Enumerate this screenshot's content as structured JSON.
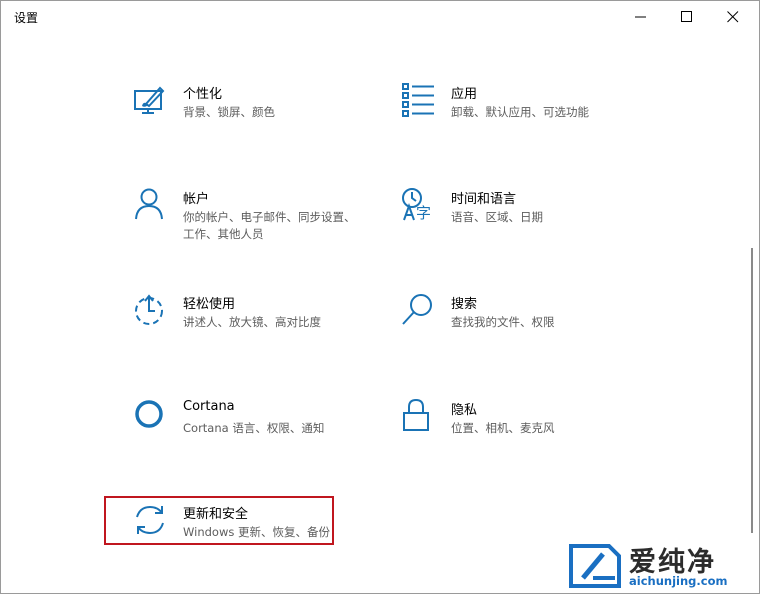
{
  "window": {
    "title": "设置"
  },
  "controls": {
    "minimize": "minimize-icon",
    "maximize": "maximize-icon",
    "close": "close-icon"
  },
  "accent_color": "#1a73b5",
  "highlight_color": "#c0161f",
  "tiles": [
    {
      "label": "个性化",
      "desc": "背景、锁屏、颜色",
      "icon": "personalization-icon"
    },
    {
      "label": "应用",
      "desc": "卸载、默认应用、可选功能",
      "icon": "apps-icon"
    },
    {
      "label": "帐户",
      "desc": "你的帐户、电子邮件、同步设置、工作、其他人员",
      "icon": "accounts-icon"
    },
    {
      "label": "时间和语言",
      "desc": "语音、区域、日期",
      "icon": "time-language-icon"
    },
    {
      "label": "轻松使用",
      "desc": "讲述人、放大镜、高对比度",
      "icon": "ease-of-access-icon"
    },
    {
      "label": "搜索",
      "desc": "查找我的文件、权限",
      "icon": "search-icon"
    },
    {
      "label": "Cortana",
      "desc": "Cortana 语言、权限、通知",
      "icon": "cortana-icon"
    },
    {
      "label": "隐私",
      "desc": "位置、相机、麦克风",
      "icon": "privacy-lock-icon"
    },
    {
      "label": "更新和安全",
      "desc": "Windows 更新、恢复、备份",
      "icon": "update-security-icon"
    }
  ],
  "watermark": {
    "main": "爱纯净",
    "sub": "aichunjing.com",
    "icon": "watermark-logo-icon"
  }
}
